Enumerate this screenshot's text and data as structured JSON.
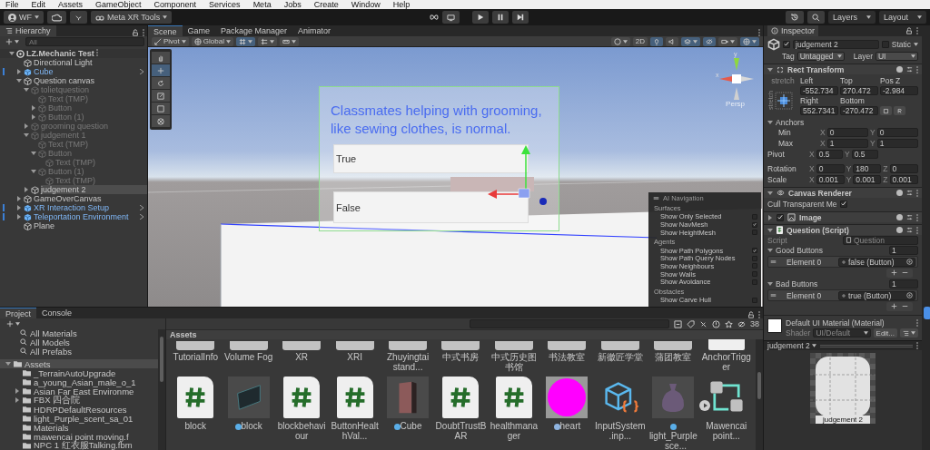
{
  "menu_bar": [
    "File",
    "Edit",
    "Assets",
    "GameObject",
    "Component",
    "Services",
    "Meta",
    "Jobs",
    "Create",
    "Window",
    "Help"
  ],
  "toolbar": {
    "account": "WF",
    "tools_menu": "Meta XR Tools",
    "layers": "Layers",
    "layout": "Layout"
  },
  "hierarchy": {
    "title": "Hierarchy",
    "search": {
      "placeholder": "All"
    },
    "scene": "LZ.Mechanic Test",
    "scene_expanded": true,
    "items": [
      {
        "label": "Directional Light",
        "kind": "object",
        "active": true,
        "selected": false
      },
      {
        "label": "Cube",
        "kind": "prefab",
        "active": true,
        "selected": false,
        "expanded": false
      },
      {
        "label": "Question canvas",
        "kind": "object",
        "active": true,
        "selected": false,
        "expanded": true,
        "children": [
          {
            "label": "tolietquestion",
            "kind": "object",
            "active": false,
            "selected": false,
            "expanded": true,
            "children": [
              {
                "label": "Text (TMP)",
                "kind": "object",
                "active": false,
                "selected": false
              },
              {
                "label": "Button",
                "kind": "object",
                "active": false,
                "selected": false,
                "expanded": false
              },
              {
                "label": "Button (1)",
                "kind": "object",
                "active": false,
                "selected": false,
                "expanded": false
              }
            ]
          },
          {
            "label": "grooming question",
            "kind": "object",
            "active": false,
            "selected": false,
            "expanded": false
          },
          {
            "label": "judgement 1",
            "kind": "object",
            "active": false,
            "selected": false,
            "expanded": true,
            "children": [
              {
                "label": "Text (TMP)",
                "kind": "object",
                "active": false,
                "selected": false
              },
              {
                "label": "Button",
                "kind": "object",
                "active": false,
                "selected": false,
                "expanded": true,
                "children": [
                  {
                    "label": "Text (TMP)",
                    "kind": "object",
                    "active": false,
                    "selected": false
                  }
                ]
              },
              {
                "label": "Button (1)",
                "kind": "object",
                "active": false,
                "selected": false,
                "expanded": true,
                "children": [
                  {
                    "label": "Text (TMP)",
                    "kind": "object",
                    "active": false,
                    "selected": false
                  }
                ]
              }
            ]
          },
          {
            "label": "judgement 2",
            "kind": "object",
            "active": true,
            "selected": true,
            "expanded": false
          }
        ]
      },
      {
        "label": "GameOverCanvas",
        "kind": "object",
        "active": true,
        "selected": false,
        "expanded": false
      },
      {
        "label": "XR Interaction Setup",
        "kind": "prefab",
        "active": true,
        "selected": false,
        "expanded": false
      },
      {
        "label": "Teleportation Environment",
        "kind": "prefab",
        "active": true,
        "selected": false,
        "expanded": false
      },
      {
        "label": "Plane",
        "kind": "object",
        "active": true,
        "selected": false
      }
    ]
  },
  "scene_view": {
    "tabs": [
      {
        "label": "Scene",
        "selected": true
      },
      {
        "label": "Game",
        "selected": false
      },
      {
        "label": "Package Manager",
        "selected": false
      },
      {
        "label": "Animator",
        "selected": false
      }
    ],
    "pivot": "Pivot",
    "space": "Global",
    "mode_2d": "2D",
    "projection": "Persp",
    "gizmo_axes": [
      "y",
      "x"
    ],
    "canvas": {
      "question": "Classmates helping with grooming, like sewing clothes, is normal.",
      "buttons": [
        "True",
        "False"
      ]
    },
    "ai_navigation": {
      "title": "AI Navigation",
      "sections": [
        {
          "title": "Surfaces",
          "options": [
            {
              "label": "Show Only Selected",
              "checked": false
            },
            {
              "label": "Show NavMesh",
              "checked": true
            },
            {
              "label": "Show HeightMesh",
              "checked": false
            }
          ]
        },
        {
          "title": "Agents",
          "options": [
            {
              "label": "Show Path Polygons",
              "checked": true
            },
            {
              "label": "Show Path Query Nodes",
              "checked": false
            },
            {
              "label": "Show Neighbours",
              "checked": false
            },
            {
              "label": "Show Walls",
              "checked": false
            },
            {
              "label": "Show Avoidance",
              "checked": false
            }
          ]
        },
        {
          "title": "Obstacles",
          "options": [
            {
              "label": "Show Carve Hull",
              "checked": false
            }
          ]
        }
      ]
    }
  },
  "inspector": {
    "title": "Inspector",
    "object": {
      "name": "judgement 2",
      "active": true,
      "static": false,
      "static_label": "Static",
      "tag_label": "Tag",
      "tag": "Untagged",
      "layer_label": "Layer",
      "layer": "UI"
    },
    "rect_transform": {
      "title": "Rect Transform",
      "expanded": true,
      "anchor_h": "stretch",
      "anchor_v": "stretch",
      "fields": [
        {
          "label": "Left",
          "value": "-552.734"
        },
        {
          "label": "Top",
          "value": "270.472"
        },
        {
          "label": "Pos Z",
          "value": "-2.984"
        },
        {
          "label": "Right",
          "value": "552.7341"
        },
        {
          "label": "Bottom",
          "value": "-270.472"
        }
      ],
      "anchors": {
        "title": "Anchors",
        "expanded": true,
        "rows": [
          {
            "label": "Min",
            "values": [
              {
                "axis": "X",
                "value": "0"
              },
              {
                "axis": "Y",
                "value": "0"
              }
            ]
          },
          {
            "label": "Max",
            "values": [
              {
                "axis": "X",
                "value": "1"
              },
              {
                "axis": "Y",
                "value": "1"
              }
            ]
          }
        ]
      },
      "pivot": {
        "label": "Pivot",
        "values": [
          {
            "axis": "X",
            "value": "0.5"
          },
          {
            "axis": "Y",
            "value": "0.5"
          }
        ]
      },
      "transform_rows": [
        {
          "label": "Rotation",
          "values": [
            {
              "axis": "X",
              "value": "0"
            },
            {
              "axis": "Y",
              "value": "180"
            },
            {
              "axis": "Z",
              "value": "0"
            }
          ]
        },
        {
          "label": "Scale",
          "values": [
            {
              "axis": "X",
              "value": "0.001"
            },
            {
              "axis": "Y",
              "value": "0.001"
            },
            {
              "axis": "Z",
              "value": "0.001"
            }
          ]
        }
      ]
    },
    "canvas_renderer": {
      "title": "Canvas Renderer",
      "expanded": true,
      "cull_label": "Cull Transparent Me",
      "cull": true
    },
    "image": {
      "title": "Image",
      "expanded": false,
      "enabled": true
    },
    "question_script": {
      "title": "Question (Script)",
      "expanded": true,
      "script_label": "Script",
      "script": "Question",
      "lists": [
        {
          "label": "Good Buttons",
          "expanded": true,
          "size": "1",
          "elements": [
            {
              "label": "Element 0",
              "value": "false (Button)"
            }
          ]
        },
        {
          "label": "Bad Buttons",
          "expanded": true,
          "size": "1",
          "elements": [
            {
              "label": "Element 0",
              "value": "true (Button)"
            }
          ]
        }
      ]
    },
    "material": {
      "name": "Default UI Material (Material)",
      "shader_label": "Shader",
      "shader": "UI/Default",
      "edit": "Edit..."
    },
    "preview": {
      "title": "judgement 2",
      "caption": "judgement 2"
    }
  },
  "project": {
    "tabs": [
      {
        "label": "Project",
        "selected": true
      },
      {
        "label": "Console",
        "selected": false
      }
    ],
    "favorites": [
      "All Materials",
      "All Models",
      "All Prefabs"
    ],
    "folders": [
      {
        "label": "Assets",
        "selected": true,
        "expanded": true,
        "children": [
          {
            "label": "_TerrainAutoUpgrade",
            "selected": false
          },
          {
            "label": "a_young_Asian_male_o_1",
            "selected": false
          },
          {
            "label": "Asian Far East Environme",
            "selected": false,
            "expanded": false
          },
          {
            "label": "FBX 四合院",
            "selected": false,
            "expanded": false
          },
          {
            "label": "HDRPDefaultResources",
            "selected": false
          },
          {
            "label": "light_Purple_scent_sa_01",
            "selected": false
          },
          {
            "label": "Materials",
            "selected": false
          },
          {
            "label": "mawencai point moving.f",
            "selected": false
          },
          {
            "label": "NPC 1 红衣服Talking.fbm",
            "selected": false
          }
        ]
      }
    ],
    "breadcrumb": "Assets",
    "count": "38",
    "asset_rows": [
      [
        {
          "label": "TutorialInfo",
          "kind": "folder"
        },
        {
          "label": "Volume Fog",
          "kind": "folder"
        },
        {
          "label": "XR",
          "kind": "folder"
        },
        {
          "label": "XRI",
          "kind": "folder"
        },
        {
          "label": "Zhuyingtai stand...",
          "kind": "folder"
        },
        {
          "label": "中式书房",
          "kind": "folder"
        },
        {
          "label": "中式历史图书馆",
          "kind": "folder"
        },
        {
          "label": "书法教室",
          "kind": "folder"
        },
        {
          "label": "新徽匠学堂",
          "kind": "folder"
        },
        {
          "label": "蒲团教室",
          "kind": "folder"
        },
        {
          "label": "AnchorTrigger",
          "kind": "script"
        }
      ],
      [
        {
          "label": "block",
          "kind": "script"
        },
        {
          "label": "block",
          "kind": "slab"
        },
        {
          "label": "blockbehaviour",
          "kind": "script"
        },
        {
          "label": "ButtonHealthVal...",
          "kind": "script"
        },
        {
          "label": "Cube",
          "kind": "pillar"
        },
        {
          "label": "DoubtTrustBAR",
          "kind": "script"
        },
        {
          "label": "healthmanager",
          "kind": "script"
        },
        {
          "label": "heart",
          "kind": "sprite"
        },
        {
          "label": "InputSystem.inp...",
          "kind": "input_actions"
        },
        {
          "label": "light_Purple_sce...",
          "kind": "model"
        },
        {
          "label": "Mawencai point...",
          "kind": "graph"
        }
      ]
    ]
  }
}
